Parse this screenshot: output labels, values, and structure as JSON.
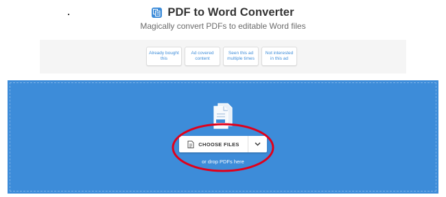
{
  "header": {
    "title": "PDF to Word Converter",
    "subtitle": "Magically convert PDFs to editable Word files"
  },
  "ad_feedback": {
    "options": [
      "Already bought this",
      "Ad covered content",
      "Seen this ad multiple times",
      "Not interested in this ad"
    ]
  },
  "dropzone": {
    "choose_label": "CHOOSE FILES",
    "drop_hint": "or drop PDFs here"
  },
  "colors": {
    "accent": "#3d8cd9",
    "annotation": "#e0001b"
  }
}
